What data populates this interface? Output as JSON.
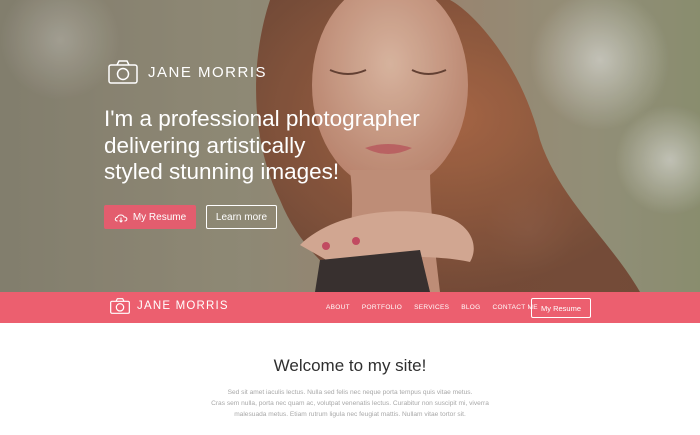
{
  "hero": {
    "brand_name": "JANE MORRIS",
    "headline_lines": [
      "I'm a professional photographer",
      "delivering artistically",
      "styled stunning images!"
    ],
    "resume_button": "My Resume",
    "learn_button": "Learn more"
  },
  "nav": {
    "brand_name": "JANE MORRIS",
    "links": [
      "ABOUT",
      "PORTFOLIO",
      "SERVICES",
      "BLOG",
      "CONTACT ME"
    ],
    "cta": "My Resume"
  },
  "main": {
    "welcome_title": "Welcome to my site!",
    "intro_lines": [
      "Sed sit amet iaculis lectus. Nulla sed felis nec neque porta tempus quis vitae metus.",
      "Cras sem nulla, porta nec quam ac, volutpat venenatis lectus. Curabitur non suscipit mi, viverra",
      "malesuada metus. Etiam rutrum ligula nec feugiat mattis. Nullam vitae tortor sit."
    ]
  },
  "colors": {
    "accent": "#ec5f6f",
    "button": "#e35d6e",
    "text_dark": "#2f2f2f",
    "text_muted": "#a8a8a8"
  }
}
